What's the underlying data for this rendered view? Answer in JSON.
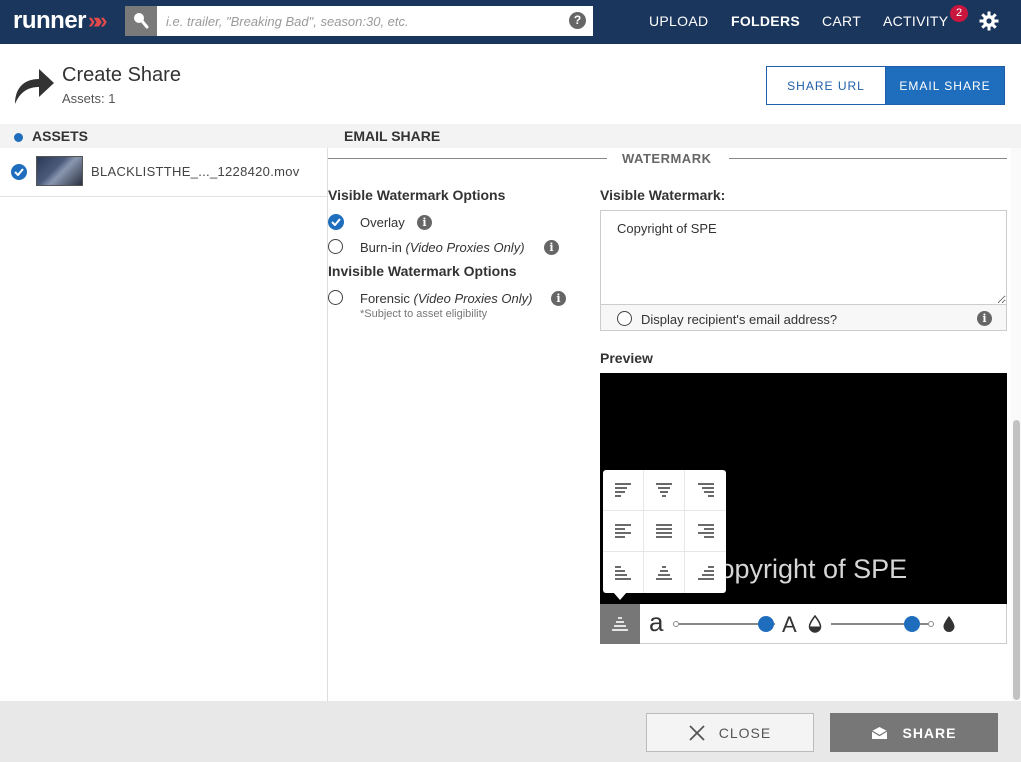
{
  "nav": {
    "logo_text": "runner",
    "logo_chevrons": "»",
    "search_placeholder": "i.e. trailer, \"Breaking Bad\", season:30, etc.",
    "help": "?",
    "items": [
      "UPLOAD",
      "FOLDERS",
      "CART",
      "ACTIVITY"
    ],
    "active": "FOLDERS",
    "activity_badge": "2"
  },
  "header": {
    "title": "Create Share",
    "subtitle": "Assets: 1",
    "share_url_label": "SHARE URL",
    "email_share_label": "EMAIL SHARE"
  },
  "columns": {
    "assets": "ASSETS",
    "email_share": "EMAIL SHARE"
  },
  "assets": [
    {
      "name": "BLACKLISTTHE_..._1228420.mov",
      "selected": true
    }
  ],
  "watermark": {
    "section_title": "WATERMARK",
    "visible_options_label": "Visible Watermark Options",
    "overlay_label": "Overlay",
    "burnin_label": "Burn-in",
    "burnin_note": "(Video Proxies Only)",
    "invisible_options_label": "Invisible Watermark Options",
    "forensic_label": "Forensic",
    "forensic_note": "(Video Proxies Only)",
    "eligibility_note": "*Subject to asset eligibility",
    "visible_watermark_label": "Visible Watermark:",
    "watermark_text": "Copyright of SPE",
    "display_email_label": "Display recipient's email address?",
    "preview_label": "Preview",
    "preview_text": "Copyright of SPE",
    "size_small_glyph": "a",
    "size_large_glyph": "A",
    "size_level": 0.91,
    "opacity_level": 0.83,
    "selected_option": "overlay"
  },
  "footer": {
    "close_label": "CLOSE",
    "share_label": "SHARE"
  },
  "colors": {
    "nav_bg": "#1b365d",
    "accent": "#1f6ebe",
    "badge": "#c8163e",
    "button_gray": "#777777"
  }
}
